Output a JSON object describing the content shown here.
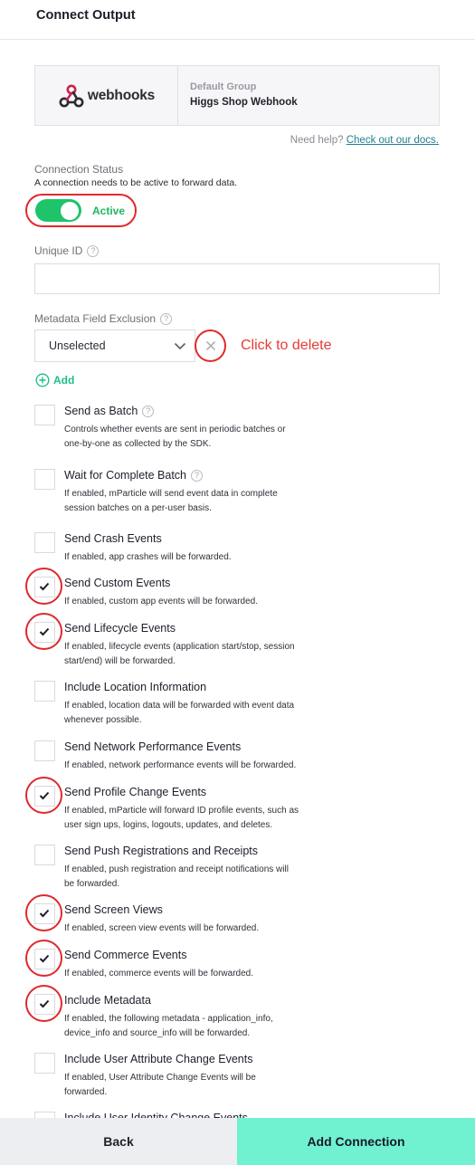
{
  "header": {
    "title": "Connect Output"
  },
  "integration": {
    "logo_text": "webhooks",
    "group_label": "Default Group",
    "group_name": "Higgs Shop Webhook"
  },
  "help": {
    "prefix": "Need help?",
    "link": "Check out our docs."
  },
  "connection_status": {
    "label": "Connection Status",
    "description": "A connection needs to be active to forward data.",
    "state_label": "Active",
    "active": true
  },
  "unique_id": {
    "label": "Unique ID",
    "value": "",
    "help_icon": "?"
  },
  "metadata_exclusion": {
    "label": "Metadata Field Exclusion",
    "selected": "Unselected",
    "annotation": "Click to delete",
    "add_label": "Add"
  },
  "options": [
    {
      "title": "Send as Batch",
      "help": true,
      "desc_lines": [
        "Controls whether events are sent in periodic batches or",
        "one-by-one as collected by the SDK."
      ],
      "checked": false
    },
    {
      "title": "Wait for Complete Batch",
      "help": true,
      "desc_lines": [
        "If enabled, mParticle will send event data in complete",
        "session batches on a per-user basis."
      ],
      "checked": false
    },
    {
      "title": "Send Crash Events",
      "help": false,
      "desc_lines": [
        "If enabled, app crashes will be forwarded."
      ],
      "checked": false
    },
    {
      "title": "Send Custom Events",
      "help": false,
      "desc_lines": [
        "If enabled, custom app events will be forwarded."
      ],
      "checked": true
    },
    {
      "title": "Send Lifecycle Events",
      "help": false,
      "desc_lines": [
        "If enabled, lifecycle events (application start/stop, session",
        "start/end) will be forwarded."
      ],
      "checked": true
    },
    {
      "title": "Include Location Information",
      "help": false,
      "desc_lines": [
        "If enabled, location data will be forwarded with event data",
        "whenever possible."
      ],
      "checked": false
    },
    {
      "title": "Send Network Performance Events",
      "help": false,
      "desc_lines": [
        "If enabled, network performance events will be forwarded."
      ],
      "checked": false
    },
    {
      "title": "Send Profile Change Events",
      "help": false,
      "desc_lines": [
        "If enabled, mParticle will forward ID profile events, such as",
        "user sign ups, logins, logouts, updates, and deletes."
      ],
      "checked": true
    },
    {
      "title": "Send Push Registrations and Receipts",
      "help": false,
      "desc_lines": [
        "If enabled, push registration and receipt notifications will",
        "be forwarded."
      ],
      "checked": false
    },
    {
      "title": "Send Screen Views",
      "help": false,
      "desc_lines": [
        "If enabled, screen view events will be forwarded."
      ],
      "checked": true
    },
    {
      "title": "Send Commerce Events",
      "help": false,
      "desc_lines": [
        "If enabled, commerce events will be forwarded."
      ],
      "checked": true
    },
    {
      "title": "Include Metadata",
      "help": false,
      "desc_lines": [
        "If enabled, the following metadata - application_info,",
        "device_info and source_info will be forwarded."
      ],
      "checked": true
    },
    {
      "title": "Include User Attribute Change Events",
      "help": false,
      "desc_lines": [
        "If enabled, User Attribute Change Events will be",
        "forwarded."
      ],
      "checked": false
    },
    {
      "title": "Include User Identity Change Events",
      "help": false,
      "desc_lines": [],
      "checked": false
    }
  ],
  "footer": {
    "back_label": "Back",
    "add_label": "Add Connection"
  },
  "colors": {
    "accent_green": "#1ec36a",
    "cta_mint": "#70f2d1",
    "annotation_red": "#e0292b",
    "link_teal": "#1f7f90"
  }
}
